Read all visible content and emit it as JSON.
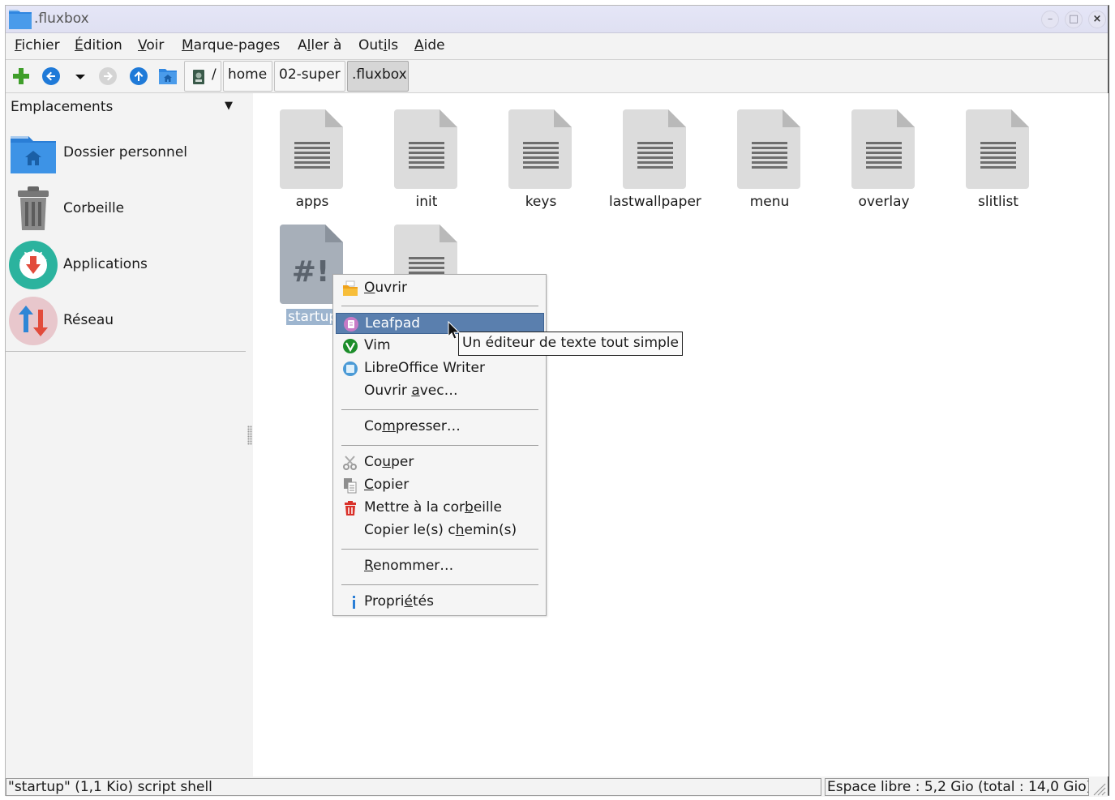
{
  "window": {
    "title": ".fluxbox"
  },
  "menubar": {
    "items": [
      {
        "pre": "",
        "u": "F",
        "post": "ichier"
      },
      {
        "pre": "",
        "u": "É",
        "post": "dition"
      },
      {
        "pre": "",
        "u": "V",
        "post": "oir"
      },
      {
        "pre": "",
        "u": "M",
        "post": "arque-pages"
      },
      {
        "pre": "A",
        "u": "l",
        "post": "ler à"
      },
      {
        "pre": "Out",
        "u": "i",
        "post": "ls"
      },
      {
        "pre": "",
        "u": "A",
        "post": "ide"
      }
    ]
  },
  "toolbar": {
    "root_label": "/",
    "breadcrumbs": [
      "home",
      "02-super",
      ".fluxbox"
    ]
  },
  "sidebar": {
    "header": "Emplacements",
    "places": [
      {
        "label": "Dossier personnel",
        "icon": "home-folder-icon"
      },
      {
        "label": "Corbeille",
        "icon": "trash-icon"
      },
      {
        "label": "Applications",
        "icon": "applications-icon"
      },
      {
        "label": "Réseau",
        "icon": "network-icon"
      }
    ]
  },
  "files": [
    {
      "name": "apps",
      "icon": "text-file-icon"
    },
    {
      "name": "init",
      "icon": "text-file-icon"
    },
    {
      "name": "keys",
      "icon": "text-file-icon"
    },
    {
      "name": "lastwallpaper",
      "icon": "text-file-icon"
    },
    {
      "name": "menu",
      "icon": "text-file-icon"
    },
    {
      "name": "overlay",
      "icon": "text-file-icon"
    },
    {
      "name": "slitlist",
      "icon": "text-file-icon"
    },
    {
      "name": "startup",
      "icon": "shell-script-icon",
      "selected": true,
      "shown": "startup"
    },
    {
      "name": "",
      "icon": "text-file-icon"
    }
  ],
  "context_menu": {
    "items": [
      {
        "pre": "",
        "u": "O",
        "post": "uvrir"
      },
      {
        "pre": "Leafpad",
        "u": "",
        "post": ""
      },
      {
        "pre": "Vim",
        "u": "",
        "post": ""
      },
      {
        "pre": "LibreOffice Writer",
        "u": "",
        "post": ""
      },
      {
        "pre": "Ouvrir ",
        "u": "a",
        "post": "vec…"
      },
      {
        "pre": "Co",
        "u": "m",
        "post": "presser…"
      },
      {
        "pre": "Co",
        "u": "u",
        "post": "per"
      },
      {
        "pre": "",
        "u": "C",
        "post": "opier"
      },
      {
        "pre": "Mettre à la cor",
        "u": "b",
        "post": "eille"
      },
      {
        "pre": "Copier le(s) c",
        "u": "h",
        "post": "emin(s)"
      },
      {
        "pre": "",
        "u": "R",
        "post": "enommer…"
      },
      {
        "pre": "Propri",
        "u": "é",
        "post": "tés"
      }
    ],
    "highlighted": "Leafpad"
  },
  "tooltip": {
    "text": "Un éditeur de texte tout simple"
  },
  "statusbar": {
    "left": "\"startup\" (1,1 Kio) script shell",
    "right": "Espace libre : 5,2 Gio (total : 14,0 Gio)"
  },
  "colors": {
    "accent": "#5a7fae",
    "selection": "#9db5cf",
    "folder": "#3b8de0"
  }
}
